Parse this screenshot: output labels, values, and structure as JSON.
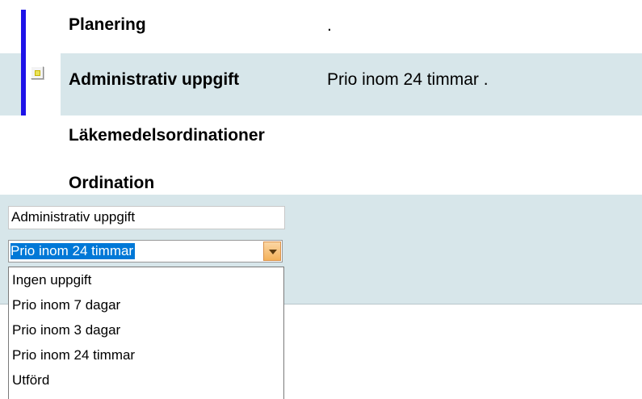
{
  "rows": {
    "planering": {
      "label": "Planering",
      "value": "."
    },
    "admin": {
      "label": "Administrativ uppgift",
      "value": "Prio inom 24 timmar ."
    },
    "lakemedel": {
      "label": "Läkemedelsordinationer"
    },
    "ordination": {
      "label": "Ordination"
    }
  },
  "editor": {
    "text_field_value": "Administrativ uppgift",
    "select_value": "Prio inom 24 timmar",
    "options": [
      "Ingen uppgift",
      "Prio inom 7 dagar",
      "Prio inom 3 dagar",
      "Prio inom 24 timmar",
      "Utförd"
    ]
  },
  "colors": {
    "accent_bar": "#1d13e8",
    "row_highlight": "#d7e6ea",
    "selection": "#0078d7",
    "dropdown_arrow": "#f4b25a"
  },
  "icons": {
    "note": "note-icon",
    "dropdown": "chevron-down-icon"
  }
}
